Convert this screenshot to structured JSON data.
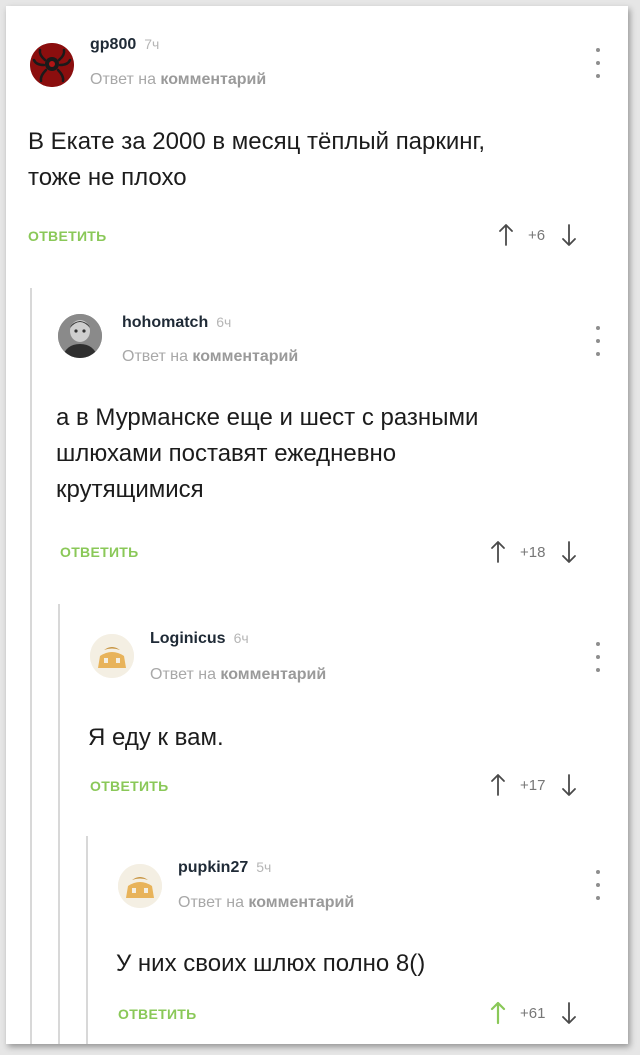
{
  "comments": [
    {
      "username": "gp800",
      "time": "7ч",
      "reply_prefix": "Ответ на",
      "reply_target": "комментарий",
      "text_lines": [
        "В Екате за 2000 в месяц тёплый паркинг,",
        "тоже не плохо"
      ],
      "reply_label": "ОТВЕТИТЬ",
      "score": "+6",
      "upvoted": false
    },
    {
      "username": "hohomatch",
      "time": "6ч",
      "reply_prefix": "Ответ на",
      "reply_target": "комментарий",
      "text_lines": [
        "а в Мурманске еще и шест с разными",
        "шлюхами поставят ежедневно",
        "крутящимися"
      ],
      "reply_label": "ОТВЕТИТЬ",
      "score": "+18",
      "upvoted": false
    },
    {
      "username": "Loginicus",
      "time": "6ч",
      "reply_prefix": "Ответ на",
      "reply_target": "комментарий",
      "text_lines": [
        "Я еду к вам."
      ],
      "reply_label": "ОТВЕТИТЬ",
      "score": "+17",
      "upvoted": false
    },
    {
      "username": "pupkin27",
      "time": "5ч",
      "reply_prefix": "Ответ на",
      "reply_target": "комментарий",
      "text_lines": [
        "У них своих шлюх полно 8()"
      ],
      "reply_label": "ОТВЕТИТЬ",
      "score": "+61",
      "upvoted": true
    }
  ],
  "colors": {
    "accent_green": "#8ac858",
    "text": "#1c1c1c",
    "meta": "#a8a8a8",
    "thread_line": "#d8d8d8"
  }
}
